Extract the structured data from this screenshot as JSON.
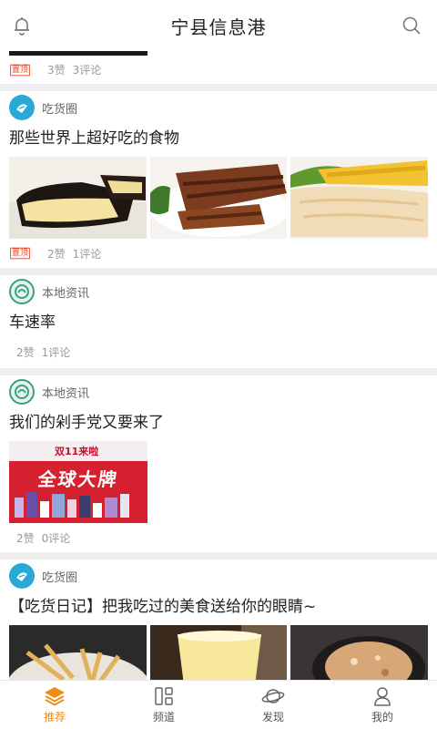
{
  "header": {
    "title": "宁县信息港",
    "bell_icon": "bell-icon",
    "search_icon": "search-icon"
  },
  "colors": {
    "accent": "#f08c1a",
    "badge": "#e8431e",
    "avatar_foodie": "#29a9d6",
    "avatar_local": "#3aa17e"
  },
  "feed": {
    "top_item": {
      "badge": "置顶",
      "likes": "3赞",
      "comments": "3评论"
    },
    "cards": [
      {
        "channel": "吃货圈",
        "title": "那些世界上超好吃的食物",
        "badge": "置顶",
        "likes": "2赞",
        "comments": "1评论"
      },
      {
        "channel": "本地资讯",
        "title": "车速率",
        "likes": "2赞",
        "comments": "1评论"
      },
      {
        "channel": "本地资讯",
        "title": "我们的剁手党又要来了",
        "banner_top": "双11来啦",
        "banner_main": "全球大牌",
        "likes": "2赞",
        "comments": "0评论"
      },
      {
        "channel": "吃货圈",
        "title": "【吃货日记】把我吃过的美食送给你的眼睛~"
      }
    ]
  },
  "tabbar": {
    "tabs": [
      {
        "label": "推荐",
        "icon": "layers-icon",
        "active": true
      },
      {
        "label": "频道",
        "icon": "grid-icon",
        "active": false
      },
      {
        "label": "发现",
        "icon": "planet-icon",
        "active": false
      },
      {
        "label": "我的",
        "icon": "user-icon",
        "active": false
      }
    ]
  }
}
